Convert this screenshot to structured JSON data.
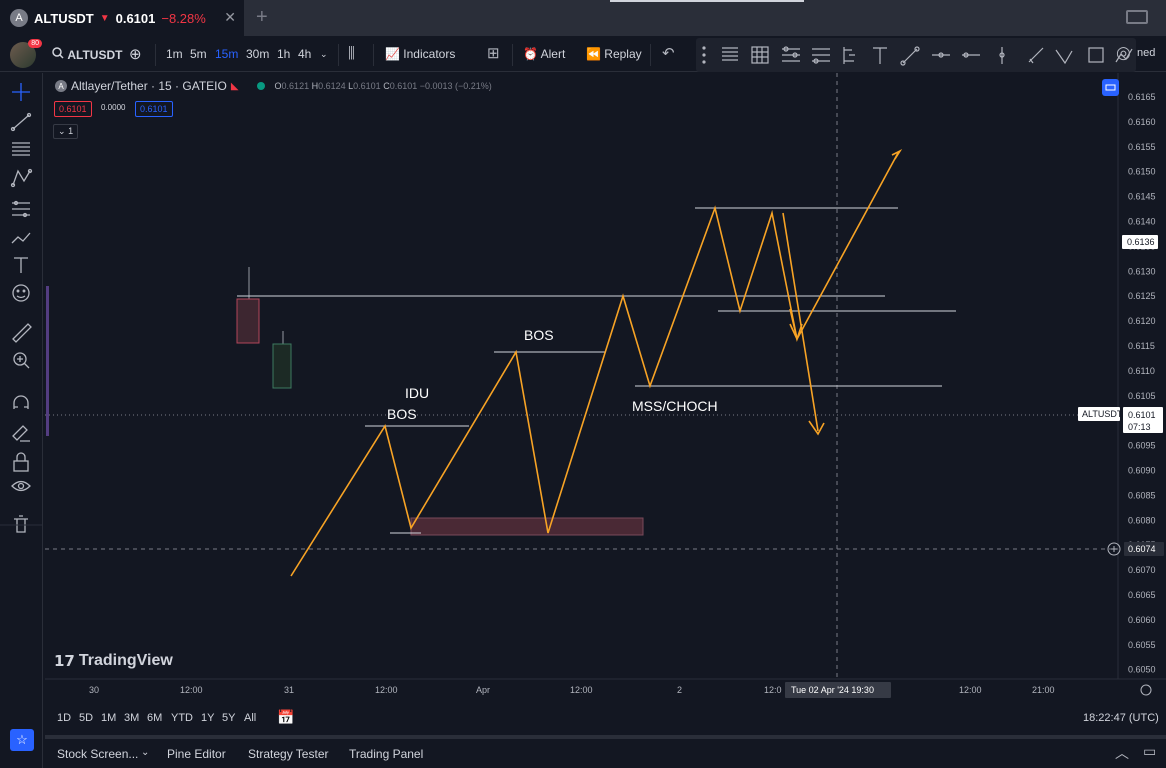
{
  "tab": {
    "favicon": "A",
    "symbol": "ALTUSDT",
    "arrow": "▼",
    "price": "0.6101",
    "change": "−8.28%",
    "close": "✕",
    "plus": "+"
  },
  "toolbar": {
    "badge": "80",
    "symbol": "ALTUSDT",
    "timeframes": [
      "1m",
      "5m",
      "15m",
      "30m",
      "1h",
      "4h"
    ],
    "active_timeframe": "15m",
    "indicators": "Indicators",
    "alert": "Alert",
    "replay": "Replay",
    "right_text": "ned"
  },
  "legend": {
    "title": "Altlayer/Tether · 15 · GATEIO",
    "open_label": "O",
    "open": "0.6121",
    "high_label": "H",
    "high": "0.6124",
    "low_label": "L",
    "low": "0.6101",
    "close_label": "C",
    "close": "0.6101",
    "change": "−0.0013 (−0.21%)",
    "bid": "0.6101",
    "spread": "0.0000",
    "ask": "0.6101",
    "indicator_count": "1"
  },
  "price_axis": {
    "labels": [
      "0.6165",
      "0.6160",
      "0.6155",
      "0.6150",
      "0.6145",
      "0.6140",
      "0.6135",
      "0.6130",
      "0.6125",
      "0.6120",
      "0.6115",
      "0.6110",
      "0.6105",
      "0.6100",
      "0.6095",
      "0.6090",
      "0.6085",
      "0.6080",
      "0.6075",
      "0.6070",
      "0.6065",
      "0.6060",
      "0.6055",
      "0.6050"
    ],
    "crosshair_label": "0.6136",
    "last_price": "0.6101",
    "countdown": "07:13",
    "symbol_tag": "ALTUSDT",
    "cursor_price": "0.6074"
  },
  "time_axis": {
    "labels": [
      "30",
      "12:00",
      "31",
      "12:00",
      "Apr",
      "12:00",
      "2",
      "12:0",
      "12:00",
      "21:00"
    ],
    "crosshair_label": "Tue 02 Apr '24   19:30"
  },
  "annotations": [
    "IDU",
    "BOS",
    "BOS",
    "MSS/CHOCH"
  ],
  "watermark": "TradingView",
  "ranges": [
    "1D",
    "5D",
    "1M",
    "3M",
    "6M",
    "YTD",
    "1Y",
    "5Y",
    "All"
  ],
  "clock": "18:22:47 (UTC)",
  "bottom_tabs": [
    "Stock Screen...",
    "Pine Editor",
    "Strategy Tester",
    "Trading Panel"
  ],
  "colors": {
    "bg": "#131722",
    "up": "#089981",
    "down": "#f23645",
    "accent": "#2962ff",
    "drawing": "#f7a325"
  },
  "icons": [
    "crosshair-icon",
    "trendline-icon",
    "fib-icon",
    "pattern-icon",
    "projection-icon",
    "brush-icon",
    "text-icon",
    "emoji-icon",
    "ruler-icon",
    "zoom-icon",
    "magnet-icon",
    "lock-drawing-icon",
    "lock-icon",
    "eye-icon",
    "trash-icon"
  ]
}
